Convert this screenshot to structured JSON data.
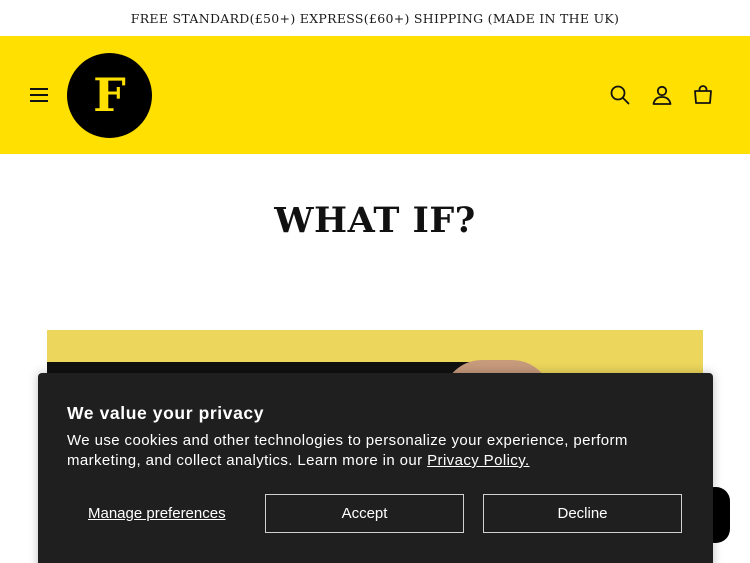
{
  "announcement": {
    "text": "FREE STANDARD(£50+) EXPRESS(£60+) SHIPPING (MADE IN THE UK)"
  },
  "header": {
    "logo_letter": "F",
    "icons": [
      "menu-icon",
      "search-icon",
      "account-icon",
      "cart-icon"
    ],
    "colors": {
      "background": "#ffe000",
      "logo_bg": "#000000",
      "logo_letter": "#ffe000"
    }
  },
  "main": {
    "title": "WHAT IF?"
  },
  "cookie_banner": {
    "title": "We value your privacy",
    "body_text": "We use cookies and other technologies to personalize your experience, perform marketing, and collect analytics. Learn more in our ",
    "policy_link": "Privacy Policy.",
    "manage_label": "Manage preferences",
    "accept_label": "Accept",
    "decline_label": "Decline",
    "colors": {
      "background": "#1f1f1f",
      "text": "#ffffff"
    }
  },
  "chat": {
    "icon": "chat-icon"
  }
}
